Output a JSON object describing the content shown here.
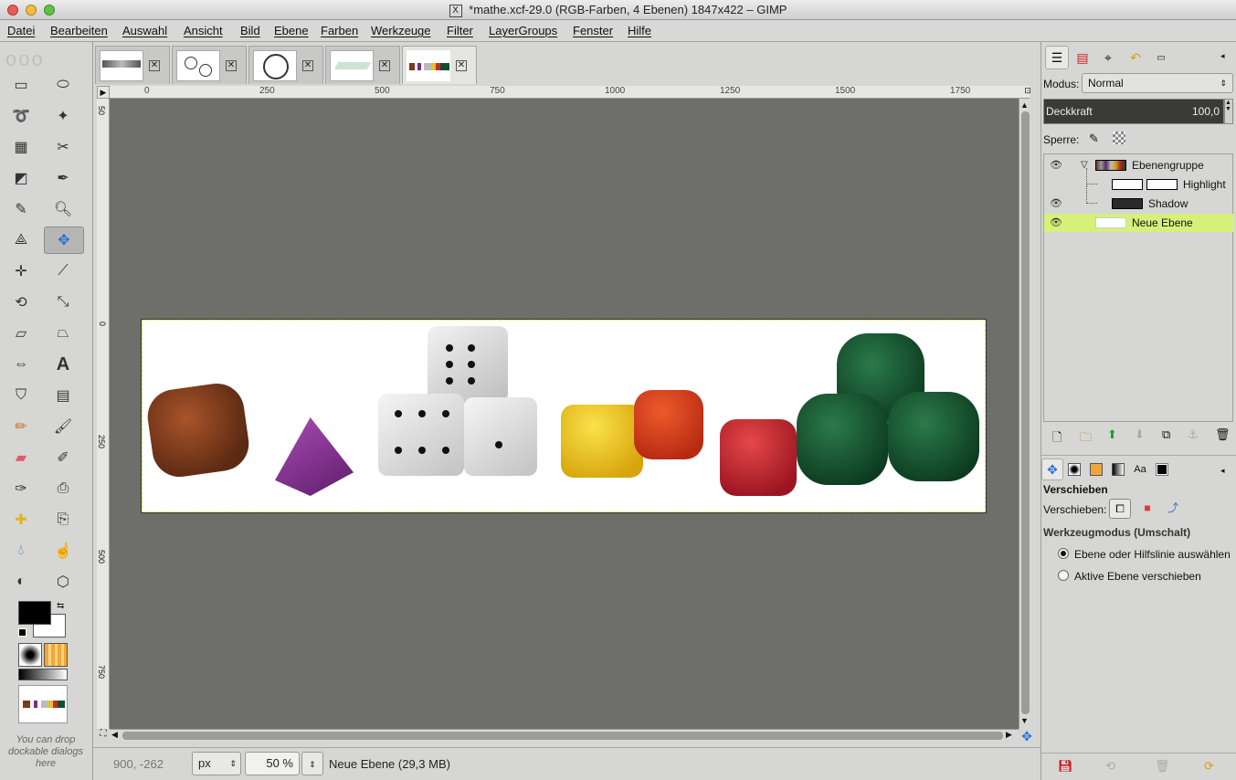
{
  "window": {
    "title": "*mathe.xcf-29.0 (RGB-Farben, 4 Ebenen) 1847x422 – GIMP"
  },
  "menu": [
    "Datei",
    "Bearbeiten",
    "Auswahl",
    "Ansicht",
    "Bild",
    "Ebene",
    "Farben",
    "Werkzeuge",
    "Filter",
    "LayerGroups",
    "Fenster",
    "Hilfe"
  ],
  "ruler_h": [
    "0",
    "250",
    "500",
    "750",
    "1000",
    "1250",
    "1500",
    "1750"
  ],
  "ruler_v": [
    "50",
    "0",
    "250",
    "500",
    "750"
  ],
  "toolbox": {
    "drop_hint": "You can drop dockable dialogs here"
  },
  "status": {
    "coords": "900, -262",
    "unit": "px",
    "zoom": "50 %",
    "layer_info": "Neue Ebene (29,3 MB)"
  },
  "layers_panel": {
    "mode_label": "Modus:",
    "mode_value": "Normal",
    "opacity_label": "Deckkraft",
    "opacity_value": "100,0",
    "lock_label": "Sperre:",
    "layers": [
      {
        "name": "Ebenengruppe",
        "visible": true,
        "active": false
      },
      {
        "name": "Highlight",
        "visible": false,
        "active": false
      },
      {
        "name": "Shadow",
        "visible": true,
        "active": false
      },
      {
        "name": "Neue Ebene",
        "visible": true,
        "active": true
      }
    ]
  },
  "tool_options": {
    "title": "Verschieben",
    "move_label": "Verschieben:",
    "mode_heading": "Werkzeugmodus (Umschalt)",
    "options": [
      "Ebene oder Hilfslinie auswählen",
      "Aktive Ebene verschieben"
    ],
    "selected_option": 0
  },
  "colors": {
    "accent_active_layer": "#d6f07a",
    "canvas_bg": "#6e6e6a",
    "dock_bg": "#d6d6d4"
  }
}
